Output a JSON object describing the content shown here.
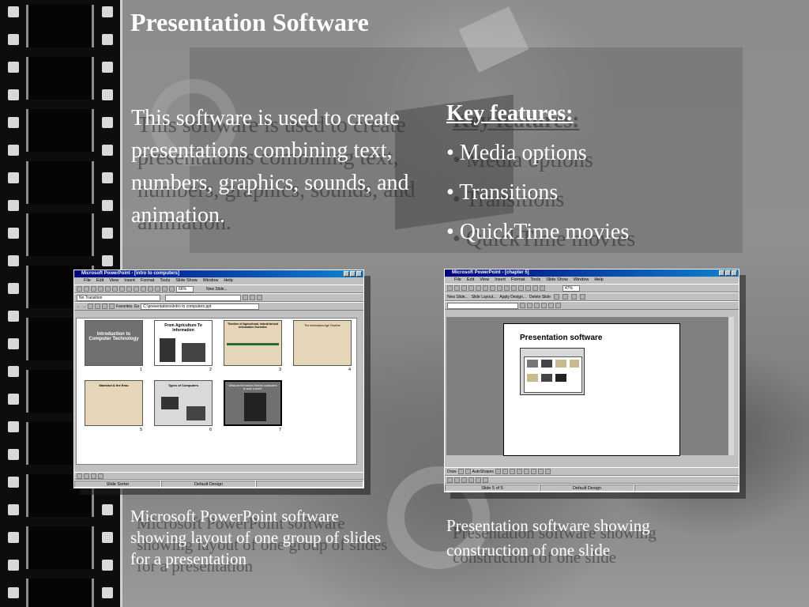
{
  "slide": {
    "title": "Presentation Software",
    "description": "This software is used to create presentations combining text, numbers, graphics, sounds, and animation.",
    "features_heading": "Key features:",
    "features": [
      "• Media options",
      "• Transitions",
      "• QuickTime movies"
    ],
    "caption_left": "Microsoft PowerPoint software showing layout of one group of slides for a presentation",
    "caption_right": "Presentation software showing construction of one slide"
  },
  "screenshot_left": {
    "window_title": "Microsoft PowerPoint - [intro to computers]",
    "menu": [
      "File",
      "Edit",
      "View",
      "Insert",
      "Format",
      "Tools",
      "Slide Show",
      "Window",
      "Help"
    ],
    "zoom": "66%",
    "new_slide": "New Slide...",
    "transition": "No Transition",
    "favorites": "Favorites",
    "go": "Go",
    "address": "C:\\presentations\\intro to computers.ppt",
    "slides": [
      {
        "num": "1",
        "title": "Introduction to Computer Technology"
      },
      {
        "num": "2",
        "title": "From Agriculture To Information"
      },
      {
        "num": "3",
        "title": "Timeline of Agricultural, Industrial and Information Societies"
      },
      {
        "num": "4",
        "title": "The Information Age Timeline"
      },
      {
        "num": "5",
        "title": "Mankind & the Eras"
      },
      {
        "num": "6",
        "title": "Types of Computers"
      },
      {
        "num": "7",
        "title": "What are the factors that led computers to such a level?"
      }
    ],
    "status_view": "Slide Sorter",
    "status_design": "Default Design"
  },
  "screenshot_right": {
    "window_title": "Microsoft PowerPoint - [chapter 5]",
    "menu": [
      "File",
      "Edit",
      "View",
      "Insert",
      "Format",
      "Tools",
      "Slide Show",
      "Window",
      "Help"
    ],
    "zoom": "47%",
    "toolbar2": [
      "New Slide...",
      "Slide Layout...",
      "Apply Design...",
      "Delete Slide"
    ],
    "slide_title": "Presentation software",
    "draw_label": "Draw",
    "autoshapes_label": "AutoShapes",
    "status_slide": "Slide 5 of 5",
    "status_design": "Default Design"
  },
  "colors": {
    "film": "#0d0d0d",
    "titlebar": "#000080",
    "text": "#ffffff"
  }
}
